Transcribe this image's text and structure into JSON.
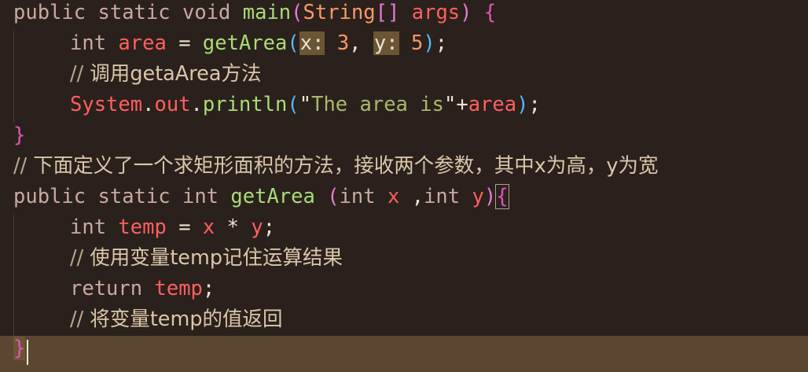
{
  "colors": {
    "background": "#2a211c",
    "current_line": "#5b4631",
    "keyword": "#c9a9a0",
    "function": "#a9dc76",
    "variable": "#ff5f5f",
    "number": "#fc9867",
    "string": "#a8b96a",
    "comment": "#b8a890",
    "comment_cjk": "#d9c7a9",
    "brace": "#e254b8",
    "paren": "#e87ad9",
    "bracket": "#57b8ff",
    "plain": "#ece2d0"
  },
  "lines": [
    {
      "tokens": [
        {
          "t": "public",
          "c": "keyword"
        },
        {
          "t": " ",
          "c": "plain"
        },
        {
          "t": "static",
          "c": "keyword"
        },
        {
          "t": " ",
          "c": "plain"
        },
        {
          "t": "void",
          "c": "keyword"
        },
        {
          "t": " ",
          "c": "plain"
        },
        {
          "t": "main",
          "c": "function"
        },
        {
          "t": "(",
          "c": "paren"
        },
        {
          "t": "String",
          "c": "number"
        },
        {
          "t": "[]",
          "c": "paren"
        },
        {
          "t": " ",
          "c": "plain"
        },
        {
          "t": "args",
          "c": "variable"
        },
        {
          "t": ")",
          "c": "paren"
        },
        {
          "t": " ",
          "c": "plain"
        },
        {
          "t": "{",
          "c": "brace"
        }
      ]
    },
    {
      "indent": 1,
      "tokens": [
        {
          "t": "int",
          "c": "keyword"
        },
        {
          "t": " ",
          "c": "plain"
        },
        {
          "t": "area",
          "c": "variable"
        },
        {
          "t": " = ",
          "c": "plain"
        },
        {
          "t": "getArea",
          "c": "function"
        },
        {
          "t": "(",
          "c": "bracket"
        },
        {
          "t": "x:",
          "c": "hint"
        },
        {
          "t": " ",
          "c": "plain"
        },
        {
          "t": "3",
          "c": "number"
        },
        {
          "t": ", ",
          "c": "plain"
        },
        {
          "t": "y:",
          "c": "hint"
        },
        {
          "t": " ",
          "c": "plain"
        },
        {
          "t": "5",
          "c": "number"
        },
        {
          "t": ")",
          "c": "bracket"
        },
        {
          "t": ";",
          "c": "plain"
        }
      ]
    },
    {
      "indent": 1,
      "tokens": [
        {
          "t": "// ",
          "c": "comment"
        },
        {
          "t": "调用",
          "c": "comment_cjk"
        },
        {
          "t": "getaArea",
          "c": "comment_cjk"
        },
        {
          "t": "方法",
          "c": "comment_cjk"
        }
      ]
    },
    {
      "indent": 1,
      "tokens": [
        {
          "t": "System",
          "c": "variable"
        },
        {
          "t": ".",
          "c": "plain"
        },
        {
          "t": "out",
          "c": "variable"
        },
        {
          "t": ".",
          "c": "plain"
        },
        {
          "t": "println",
          "c": "function"
        },
        {
          "t": "(",
          "c": "bracket"
        },
        {
          "t": "\"",
          "c": "plain"
        },
        {
          "t": "The area is",
          "c": "string"
        },
        {
          "t": "\"",
          "c": "plain"
        },
        {
          "t": "+",
          "c": "plain"
        },
        {
          "t": "area",
          "c": "variable"
        },
        {
          "t": ")",
          "c": "bracket"
        },
        {
          "t": ";",
          "c": "plain"
        }
      ]
    },
    {
      "tokens": [
        {
          "t": "}",
          "c": "brace"
        }
      ]
    },
    {
      "tokens": [
        {
          "t": "// ",
          "c": "comment"
        },
        {
          "t": "下面定义了一个求矩形面积的方法，接收两个参数，其中x为高，y为宽",
          "c": "comment_cjk"
        }
      ]
    },
    {
      "tokens": [
        {
          "t": "public",
          "c": "keyword"
        },
        {
          "t": " ",
          "c": "plain"
        },
        {
          "t": "static",
          "c": "keyword"
        },
        {
          "t": " ",
          "c": "plain"
        },
        {
          "t": "int",
          "c": "keyword"
        },
        {
          "t": " ",
          "c": "plain"
        },
        {
          "t": "getArea",
          "c": "function"
        },
        {
          "t": " ",
          "c": "plain"
        },
        {
          "t": "(",
          "c": "paren"
        },
        {
          "t": "int",
          "c": "keyword"
        },
        {
          "t": " ",
          "c": "plain"
        },
        {
          "t": "x",
          "c": "variable"
        },
        {
          "t": " ,",
          "c": "plain"
        },
        {
          "t": "int",
          "c": "keyword"
        },
        {
          "t": " ",
          "c": "plain"
        },
        {
          "t": "y",
          "c": "variable"
        },
        {
          "t": ")",
          "c": "paren"
        },
        {
          "t": "{",
          "c": "brace_match"
        }
      ]
    },
    {
      "indent": 1,
      "tokens": [
        {
          "t": "int",
          "c": "keyword"
        },
        {
          "t": " ",
          "c": "plain"
        },
        {
          "t": "temp",
          "c": "variable"
        },
        {
          "t": " = ",
          "c": "plain"
        },
        {
          "t": "x",
          "c": "variable"
        },
        {
          "t": " * ",
          "c": "plain"
        },
        {
          "t": "y",
          "c": "variable"
        },
        {
          "t": ";",
          "c": "plain"
        }
      ]
    },
    {
      "indent": 1,
      "tokens": [
        {
          "t": "// ",
          "c": "comment"
        },
        {
          "t": "使用变量",
          "c": "comment_cjk"
        },
        {
          "t": "temp",
          "c": "comment_cjk"
        },
        {
          "t": "记住运算结果",
          "c": "comment_cjk"
        }
      ]
    },
    {
      "indent": 1,
      "tokens": [
        {
          "t": "return",
          "c": "keyword"
        },
        {
          "t": " ",
          "c": "plain"
        },
        {
          "t": "temp",
          "c": "variable"
        },
        {
          "t": ";",
          "c": "plain"
        }
      ]
    },
    {
      "indent": 1,
      "tokens": [
        {
          "t": "// ",
          "c": "comment"
        },
        {
          "t": "将变量",
          "c": "comment_cjk"
        },
        {
          "t": "temp",
          "c": "comment_cjk"
        },
        {
          "t": "的值返回",
          "c": "comment_cjk"
        }
      ]
    },
    {
      "current": true,
      "tokens": [
        {
          "t": "}",
          "c": "brace_match"
        }
      ]
    }
  ]
}
